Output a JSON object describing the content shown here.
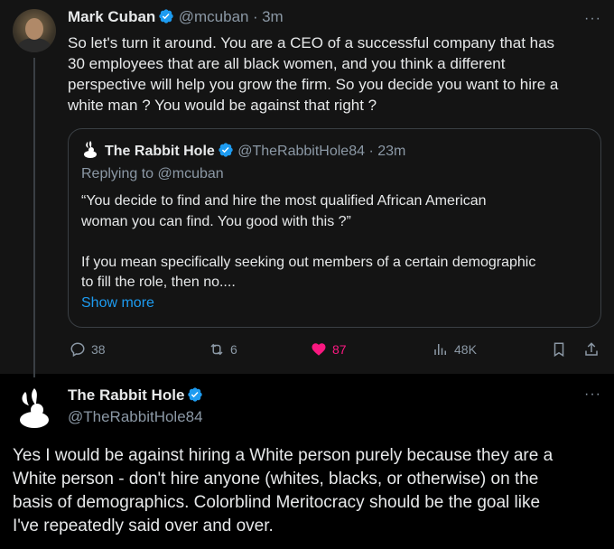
{
  "parent_tweet": {
    "author_name": "Mark Cuban",
    "author_handle": "@mcuban",
    "time": "3m",
    "text": "So let's turn it around.  You are a  CEO of a successful company  that has\n30 employees that are all black women, and you think a different\nperspective will help you grow the firm. So  you decide you want to hire a\nwhite man ? You would be against that right ?",
    "more_label": "···"
  },
  "quoted_tweet": {
    "author_name": "The Rabbit Hole",
    "author_handle": "@TheRabbitHole84",
    "time": "23m",
    "replying_to": "Replying to @mcuban",
    "text": "“You decide to find and hire the most qualified African American\nwoman you can find. You good with this ?”\n\nIf you mean specifically seeking out members of a certain demographic\nto fill the role, then no....",
    "show_more": "Show more"
  },
  "actions": {
    "replies": "38",
    "retweets": "6",
    "likes": "87",
    "views": "48K"
  },
  "reply_tweet": {
    "author_name": "The Rabbit Hole",
    "author_handle": "@TheRabbitHole84",
    "text": "Yes I would be against hiring a White person purely because they are a\nWhite person - don't hire anyone (whites, blacks, or otherwise) on the\nbasis of demographics. Colorblind Meritocracy should be the goal like\nI've repeatedly said over and over.",
    "more_label": "···"
  },
  "colors": {
    "accent_blue": "#1d9bf0",
    "like_pink": "#f91880",
    "secondary_text": "#8b98a5"
  },
  "icons": [
    "verified-badge-icon",
    "rabbit-logo-icon",
    "reply-icon",
    "retweet-icon",
    "heart-icon",
    "views-icon",
    "bookmark-icon",
    "share-icon",
    "more-icon"
  ]
}
